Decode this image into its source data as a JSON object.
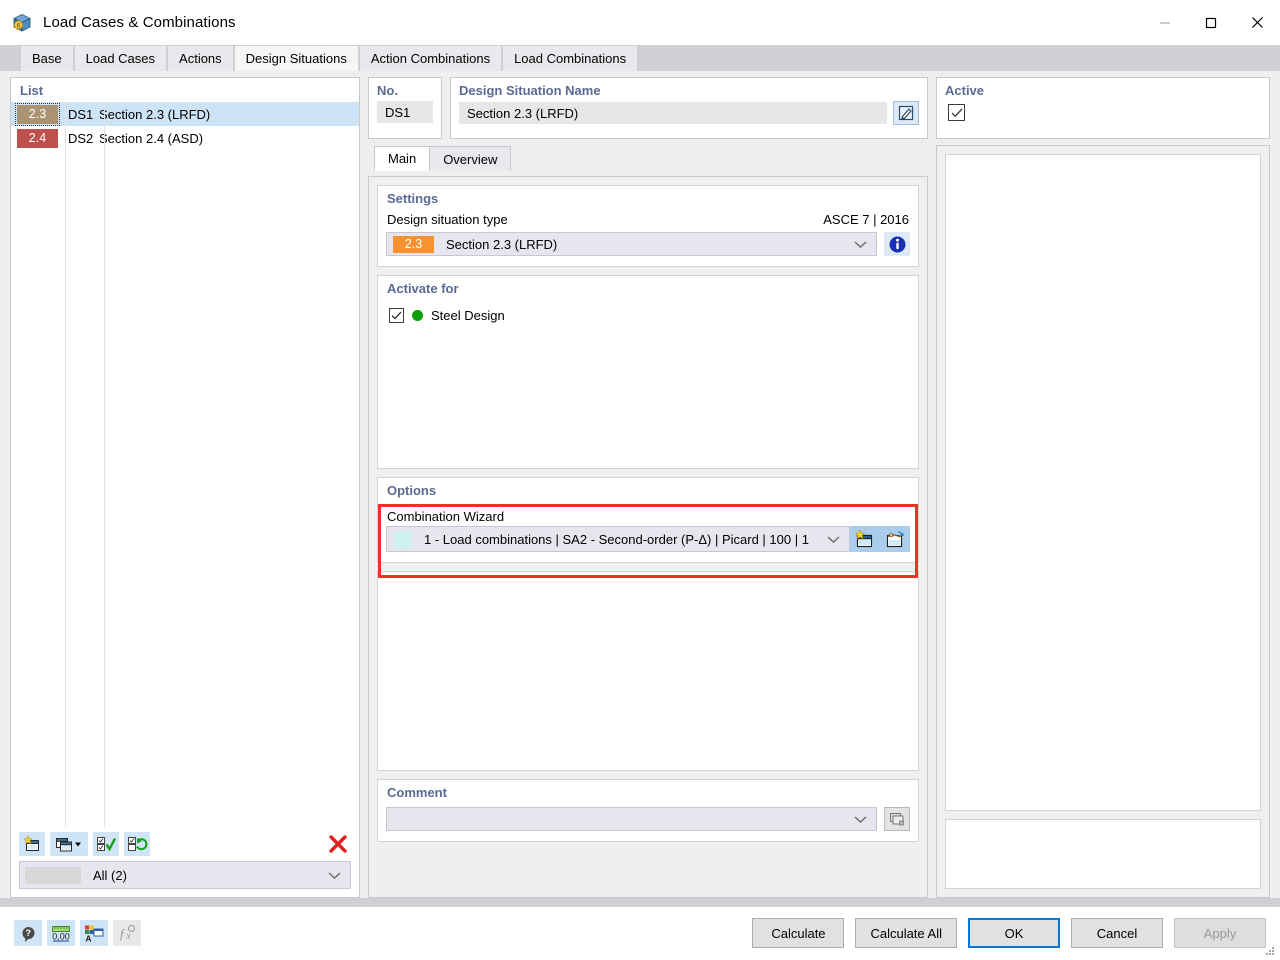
{
  "window": {
    "title": "Load Cases & Combinations",
    "icon": "app-cube-icon",
    "minimize_label": "Minimize",
    "maximize_label": "Maximize",
    "close_label": "Close"
  },
  "tabs": [
    {
      "label": "Base",
      "active": false
    },
    {
      "label": "Load Cases",
      "active": false
    },
    {
      "label": "Actions",
      "active": false
    },
    {
      "label": "Design Situations",
      "active": true
    },
    {
      "label": "Action Combinations",
      "active": false
    },
    {
      "label": "Load Combinations",
      "active": false
    }
  ],
  "list": {
    "title": "List",
    "rows": [
      {
        "badge": "2.3",
        "badge_color": "#ab9372",
        "id": "DS1",
        "name": "Section 2.3 (LRFD)",
        "selected": true
      },
      {
        "badge": "2.4",
        "badge_color": "#c0504d",
        "id": "DS2",
        "name": "Section 2.4 (ASD)",
        "selected": false
      }
    ],
    "toolbar": {
      "new_label": "New",
      "copy_label": "Copy",
      "copy_dropdown_label": "Copy options",
      "select_all_label": "Select all",
      "invert_label": "Invert selection",
      "delete_label": "Delete"
    },
    "filter": {
      "value": "All (2)"
    }
  },
  "no_field": {
    "label": "No.",
    "value": "DS1"
  },
  "name_field": {
    "label": "Design Situation Name",
    "value": "Section 2.3 (LRFD)",
    "edit_button_label": "Edit name"
  },
  "active_field": {
    "label": "Active",
    "checked": true
  },
  "subtabs": [
    {
      "label": "Main",
      "active": true
    },
    {
      "label": "Overview",
      "active": false
    }
  ],
  "settings": {
    "title": "Settings",
    "row_label": "Design situation type",
    "standard": "ASCE 7 | 2016",
    "combo": {
      "badge": "2.3",
      "badge_color": "#f79232",
      "value": "Section 2.3 (LRFD)"
    },
    "info_button_label": "Info"
  },
  "activate_for": {
    "title": "Activate for",
    "items": [
      {
        "label": "Steel Design",
        "checked": true,
        "dot_color": "#0aa00a"
      }
    ]
  },
  "options": {
    "title": "Options",
    "wizard_label": "Combination Wizard",
    "wizard_value": "1 - Load combinations | SA2 - Second-order (P-Δ) | Picard | 100 | 1",
    "wizard_new_button_label": "New combination wizard",
    "wizard_edit_button_label": "Edit combination wizard",
    "highlight_color": "#ee3124"
  },
  "comment": {
    "title": "Comment",
    "value": "",
    "placeholder": "",
    "button_label": "Select comment"
  },
  "footer": {
    "icons": [
      {
        "name": "help-icon",
        "label": "Help",
        "disabled": false
      },
      {
        "name": "units-icon",
        "label": "Units and Decimal Places",
        "disabled": false
      },
      {
        "name": "display-properties-icon",
        "label": "Display Properties",
        "disabled": false
      },
      {
        "name": "formula-icon",
        "label": "Formula",
        "disabled": true
      }
    ],
    "buttons": [
      {
        "label": "Calculate",
        "primary": false,
        "disabled": false
      },
      {
        "label": "Calculate All",
        "primary": false,
        "disabled": false
      },
      {
        "label": "OK",
        "primary": true,
        "disabled": false
      },
      {
        "label": "Cancel",
        "primary": false,
        "disabled": false
      },
      {
        "label": "Apply",
        "primary": false,
        "disabled": true
      }
    ]
  }
}
